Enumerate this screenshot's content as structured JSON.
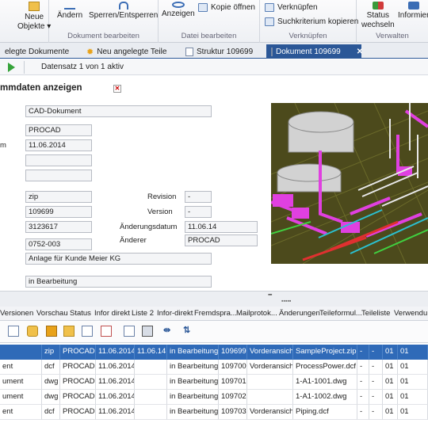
{
  "ribbon": {
    "groups": [
      {
        "label": ""
      },
      {
        "label": "Dokument bearbeiten"
      },
      {
        "label": "Datei bearbeiten"
      },
      {
        "label": "Verknüpfen"
      },
      {
        "label": "Verwalten"
      }
    ],
    "buttons": {
      "neue_objekte": "Neue\nObjekte ▾",
      "aendern": "Ändern",
      "sperren": "Sperren/Entsperren",
      "anzeigen": "Anzeigen",
      "kopie_oeffnen": "Kopie öffnen",
      "verknuepfen": "Verknüpfen",
      "suchkriterium": "Suchkriterium kopieren",
      "status_wechseln": "Status\nwechseln",
      "informieren": "Informier"
    }
  },
  "tabs": [
    {
      "label": "elegte Dokumente",
      "icon": "none"
    },
    {
      "label": "Neu angelegte Teile",
      "icon": "star-icon"
    },
    {
      "label": "Struktur 109699",
      "icon": "document-icon"
    },
    {
      "label": "Dokument 109699",
      "icon": "document-icon",
      "active": true
    }
  ],
  "nav": {
    "record_text": "Datensatz 1 von 1 aktiv"
  },
  "form": {
    "title": "mmdaten anzeigen",
    "cutoff_label": "m",
    "fields": {
      "typ": "CAD-Dokument",
      "ersteller": "PROCAD",
      "datum": "11.06.2014",
      "f1": "",
      "f2": "",
      "format": "zip",
      "nummer": "109699",
      "n2": "3123617",
      "n3": "0752-003",
      "beschreibung": "Anlage für Kunde Meier KG",
      "status": "in Bearbeitung",
      "revision": "-",
      "version": "-",
      "aenderungsdatum": "11.06.14",
      "aenderer": "PROCAD"
    },
    "labels": {
      "revision": "Revision",
      "version": "Version",
      "aenderungsdatum": "Änderungsdatum",
      "aenderer": "Änderer"
    }
  },
  "lower_tabs": [
    "Versionen",
    "Vorschau",
    "Status",
    "Infor direkt",
    "Liste 2",
    "Infor-direkt",
    "Fremdspra...",
    "Mailprotok...",
    "Änderungen",
    "Teileformul...",
    "Teileliste",
    "Verwendu..."
  ],
  "grid": {
    "rows": [
      [
        "",
        "zip",
        "PROCAD",
        "11.06.2014",
        "11.06.14",
        "in Bearbeitung",
        "109699",
        "Vorderansicht",
        "SampleProject.zip",
        "-",
        "-",
        "01",
        "01"
      ],
      [
        "ent",
        "dcf",
        "PROCAD",
        "11.06.2014",
        "",
        "in Bearbeitung",
        "109700",
        "Vorderansicht",
        "ProcessPower.dcf",
        "-",
        "-",
        "01",
        "01"
      ],
      [
        "ument",
        "dwg",
        "PROCAD",
        "11.06.2014",
        "",
        "in Bearbeitung",
        "109701",
        "",
        "1-A1-1001.dwg",
        "-",
        "-",
        "01",
        "01"
      ],
      [
        "ument",
        "dwg",
        "PROCAD",
        "11.06.2014",
        "",
        "in Bearbeitung",
        "109702",
        "",
        "1-A1-1002.dwg",
        "-",
        "-",
        "01",
        "01"
      ],
      [
        "ent",
        "dcf",
        "PROCAD",
        "11.06.2014",
        "",
        "in Bearbeitung",
        "109703",
        "Vorderansicht",
        "Piping.dcf",
        "-",
        "-",
        "01",
        "01"
      ]
    ]
  }
}
